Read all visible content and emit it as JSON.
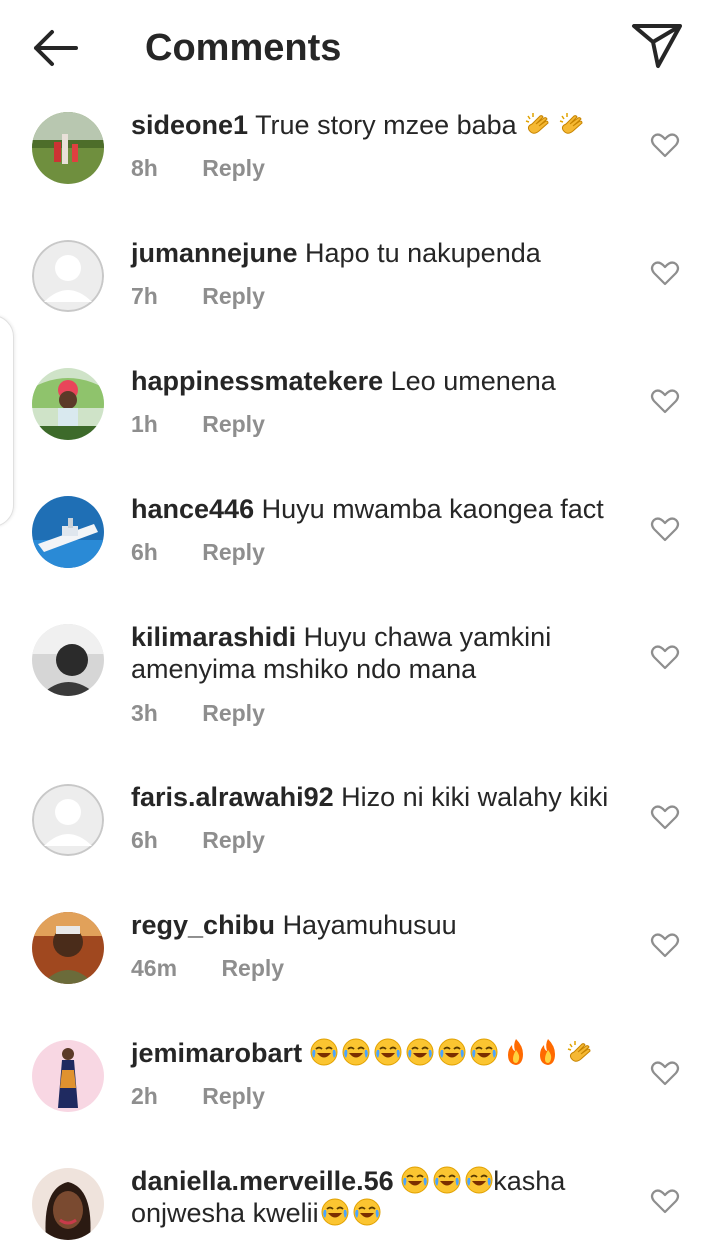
{
  "header": {
    "title": "Comments",
    "back_icon": "arrow-left-icon",
    "share_icon": "paper-plane-icon"
  },
  "comments": [
    {
      "username": "sideone1",
      "text": "True story mzee baba",
      "emoji": [
        "clapping-hands",
        "clapping-hands"
      ],
      "time": "8h",
      "reply": "Reply"
    },
    {
      "username": "jumannejune",
      "text": "Hapo tu nakupenda",
      "emoji": [],
      "time": "7h",
      "reply": "Reply"
    },
    {
      "username": "happinessmatekere",
      "text": "Leo umenena",
      "emoji": [],
      "time": "1h",
      "reply": "Reply"
    },
    {
      "username": "hance446",
      "text": "Huyu mwamba kaongea fact",
      "emoji": [],
      "time": "6h",
      "reply": "Reply"
    },
    {
      "username": "kilimarashidi",
      "text": "Huyu chawa yamkini amenyima mshiko ndo mana",
      "emoji": [],
      "time": "3h",
      "reply": "Reply"
    },
    {
      "username": "faris.alrawahi92",
      "text": "Hizo ni kiki walahy kiki",
      "emoji": [],
      "time": "6h",
      "reply": "Reply"
    },
    {
      "username": "regy_chibu",
      "text": "Hayamuhusuu",
      "emoji": [],
      "time": "46m",
      "reply": "Reply"
    },
    {
      "username": "jemimarobart",
      "text": "",
      "emoji": [
        "face-with-tears-of-joy",
        "face-with-tears-of-joy",
        "face-with-tears-of-joy",
        "face-with-tears-of-joy",
        "face-with-tears-of-joy",
        "face-with-tears-of-joy",
        "fire",
        "fire",
        "clapping-hands"
      ],
      "time": "2h",
      "reply": "Reply"
    },
    {
      "username": "daniella.merveille.56",
      "text_parts": [
        "kasha onjwesha kwelii"
      ],
      "emoji": [
        "face-with-tears-of-joy",
        "face-with-tears-of-joy",
        "face-with-tears-of-joy",
        "face-with-tears-of-joy",
        "face-with-tears-of-joy"
      ],
      "time": "",
      "reply": ""
    }
  ],
  "colors": {
    "text": "#262626",
    "meta": "#8e8e8e"
  }
}
